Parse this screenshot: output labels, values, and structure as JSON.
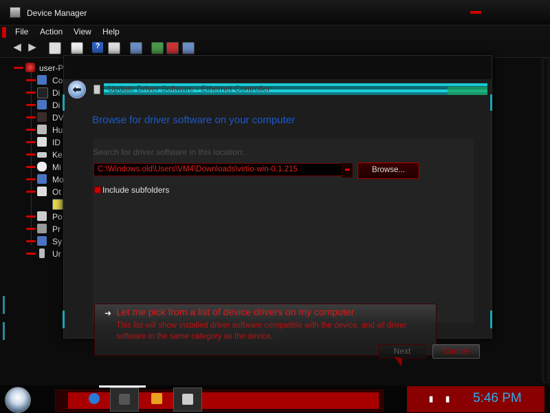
{
  "window": {
    "title": "Device Manager"
  },
  "menu": [
    "File",
    "Action",
    "View",
    "Help"
  ],
  "tree": {
    "root": "user-P",
    "items": [
      "Co",
      "Di",
      "Di",
      "DV",
      "Hu",
      "ID",
      "Ke",
      "Mi",
      "Mo",
      "Ot",
      "Po",
      "Pr",
      "Sy",
      "Ur"
    ]
  },
  "dialog": {
    "title": "Update Driver Software - Ethernet Controller",
    "heading": "Browse for driver software on your computer",
    "search_label": "Search for driver software in this location:",
    "path": "C:\\Windows.old\\Users\\VM4\\Downloads\\virtio-win-0.1.215",
    "browse": "Browse...",
    "include_subfolders": "Include subfolders",
    "pick_title": "Let me pick from a list of device drivers on my computer",
    "pick_desc": "This list will show installed driver software compatible with the device, and all driver software in the same category as the device.",
    "next": "Next",
    "cancel": "Cancel"
  },
  "taskbar": {
    "clock": "5:46 PM"
  },
  "colors": {
    "accent_red": "#d00000",
    "heading_blue": "#1e5ac8",
    "link_red": "#e31818"
  }
}
